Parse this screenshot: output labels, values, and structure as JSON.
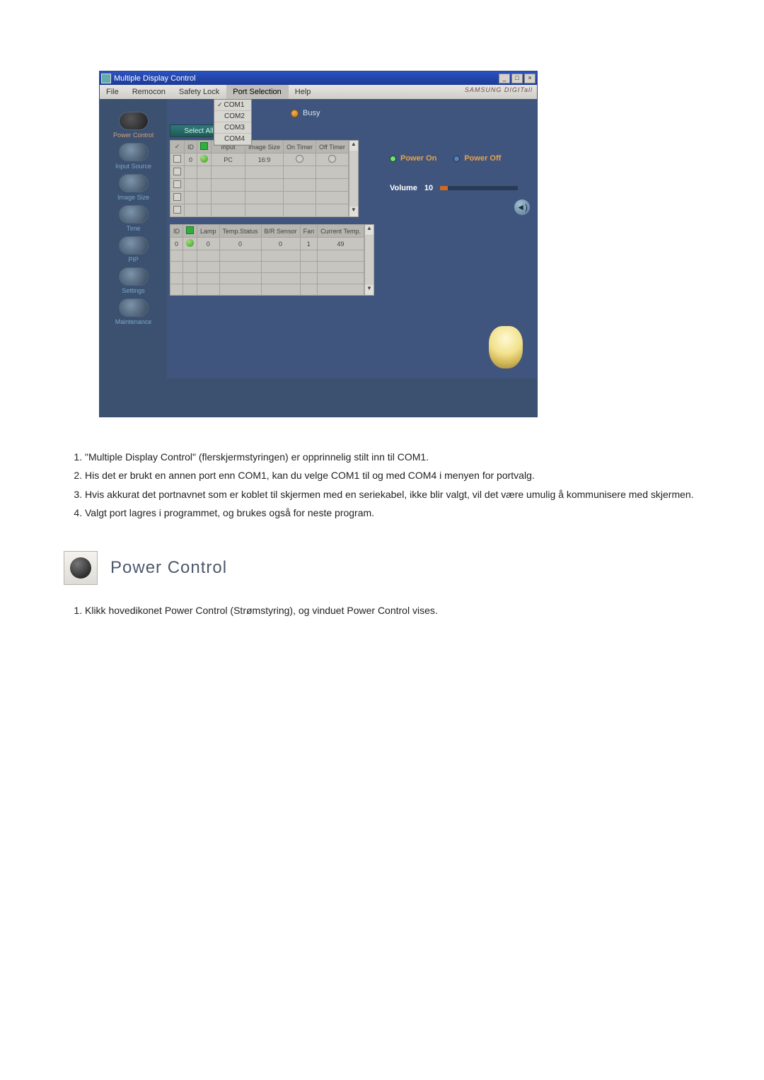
{
  "window": {
    "title": "Multiple Display Control",
    "brand": "SAMSUNG DIGITall"
  },
  "menubar": {
    "file": "File",
    "remocon": "Remocon",
    "safety": "Safety Lock",
    "port": "Port Selection",
    "help": "Help"
  },
  "port_dropdown": {
    "items": [
      "COM1",
      "COM2",
      "COM3",
      "COM4"
    ],
    "selected": "COM1"
  },
  "sidebar": {
    "items": [
      {
        "label": "Power Control",
        "name": "power-control",
        "active": true
      },
      {
        "label": "Input Source",
        "name": "input-source",
        "active": false
      },
      {
        "label": "Image Size",
        "name": "image-size",
        "active": false
      },
      {
        "label": "Time",
        "name": "time",
        "active": false
      },
      {
        "label": "PIP",
        "name": "pip",
        "active": false
      },
      {
        "label": "Settings",
        "name": "settings",
        "active": false
      },
      {
        "label": "Maintenance",
        "name": "maintenance",
        "active": false
      }
    ]
  },
  "select_all": "Select All",
  "status": {
    "busy": "Busy"
  },
  "grid1": {
    "headers": {
      "chk": "✓",
      "id": "ID",
      "pwr": "⏻",
      "input": "Input",
      "image": "Image Size",
      "ontimer": "On Timer",
      "offtimer": "Off Timer"
    },
    "row": {
      "id": "0",
      "input": "PC",
      "image": "16:9"
    }
  },
  "grid2": {
    "headers": {
      "id": "ID",
      "pwr": "⏻",
      "lamp": "Lamp",
      "temp": "Temp.Status",
      "br": "B/R Sensor",
      "fan": "Fan",
      "curtemp": "Current Temp."
    },
    "row": {
      "id": "0",
      "lamp": "0",
      "temp": "0",
      "br": "0",
      "fan": "1",
      "curtemp": "49"
    }
  },
  "power": {
    "on": "Power On",
    "off": "Power Off"
  },
  "volume": {
    "label": "Volume",
    "value": "10"
  },
  "doc": {
    "list": {
      "i1": "\"Multiple Display Control\" (flerskjermstyringen) er opprinnelig stilt inn til COM1.",
      "i2": "His det er brukt en annen port enn COM1, kan du velge COM1 til og med COM4 i menyen for portvalg.",
      "i3": "Hvis akkurat det portnavnet som er koblet til skjermen med en seriekabel, ikke blir valgt, vil det være umulig å kommunisere med skjermen.",
      "i4": "Valgt port lagres i programmet, og brukes også for neste program."
    },
    "section_title": "Power Control",
    "section_item": "Klikk hovedikonet Power Control (Strømstyring), og vinduet Power Control vises."
  }
}
